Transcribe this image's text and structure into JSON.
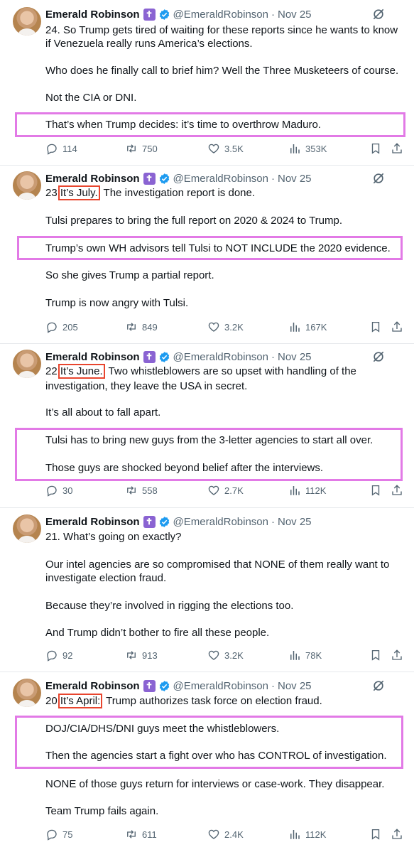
{
  "author": {
    "name": "Emerald Robinson",
    "handle": "@EmeraldRobinson",
    "separator": "·",
    "cross_glyph": "✝"
  },
  "colors": {
    "highlight_pink": "#e27ae6",
    "highlight_red": "#e8452e",
    "verified_blue": "#1d9bf0",
    "cross_purple": "#8a63d2"
  },
  "tweets": [
    {
      "date": "Nov 25",
      "lines": [
        "24. So Trump gets tired of waiting for these reports since he wants to know",
        "if Venezuela really runs America’s elections.",
        "Who does he finally call to brief him? Well the Three Musketeers of course.",
        "Not the CIA or DNI.",
        "That’s when Trump decides: it’s time to overthrow Maduro."
      ],
      "stats": {
        "replies": "114",
        "reposts": "750",
        "likes": "3.5K",
        "views": "353K"
      }
    },
    {
      "date": "Nov 25",
      "num": "23.",
      "boxed": "It’s July.",
      "rest": " The investigation report is done.",
      "lines": [
        "Tulsi prepares to bring the full report on 2020 & 2024 to Trump.",
        "Trump’s own WH advisors tell Tulsi to NOT INCLUDE the 2020 evidence.",
        "So she gives Trump a partial report.",
        "Trump is now angry with Tulsi."
      ],
      "stats": {
        "replies": "205",
        "reposts": "849",
        "likes": "3.2K",
        "views": "167K"
      }
    },
    {
      "date": "Nov 25",
      "num": "22.",
      "boxed": "It’s June.",
      "rest": " Two whistleblowers are so upset with handling of the",
      "lines": [
        "investigation, they leave the USA in secret.",
        "It’s all about to fall apart.",
        "Tulsi has to bring new guys from the 3-letter agencies to start all over.",
        "Those guys are shocked beyond belief after the interviews."
      ],
      "stats": {
        "replies": "30",
        "reposts": "558",
        "likes": "2.7K",
        "views": "112K"
      }
    },
    {
      "date": "Nov 25",
      "lines": [
        "21. What’s going on exactly?",
        "Our intel agencies are so compromised that NONE of them really want to",
        "investigate election fraud.",
        "Because they’re involved in rigging the elections too.",
        "And Trump didn’t bother to fire all these people."
      ],
      "stats": {
        "replies": "92",
        "reposts": "913",
        "likes": "3.2K",
        "views": "78K"
      }
    },
    {
      "date": "Nov 25",
      "num": "20.",
      "boxed": "It’s April:",
      "rest": " Trump authorizes task force on election fraud.",
      "lines": [
        "DOJ/CIA/DHS/DNI guys meet the whistleblowers.",
        "Then the agencies start a fight over who has CONTROL of investigation.",
        "NONE of those guys return for interviews or case-work. They disappear.",
        "Team Trump fails again."
      ],
      "stats": {
        "replies": "75",
        "reposts": "611",
        "likes": "2.4K",
        "views": "112K"
      }
    }
  ]
}
